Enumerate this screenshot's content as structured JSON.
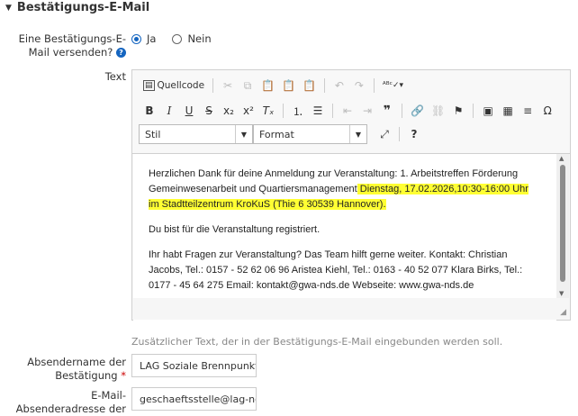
{
  "section": {
    "title": "Bestätigungs-E-Mail"
  },
  "confirm": {
    "label_line1": "Eine Bestätigungs-E-",
    "label_line2": "Mail versenden?",
    "help": "?",
    "yes": "Ja",
    "no": "Nein"
  },
  "text": {
    "label": "Text"
  },
  "toolbar": {
    "source": "Quellcode",
    "style": "Stil",
    "format": "Format"
  },
  "content": {
    "p1_a": "Herzlichen Dank für deine Anmeldung zur Veranstaltung: 1. Arbeitstreffen Förderung Gemeinwesenarbeit und Quartiersmanagement",
    "p1_b": " Dienstag, 17.02.2026,10:30-16:00 Uhr im Stadtteilzentrum KroKuS (Thie 6 30539 Hannover).",
    "p2": "Du bist für die Veranstaltung registriert.",
    "p3": "Ihr habt Fragen zur Veranstaltung? Das Team hilft gerne weiter. Kontakt: Christian Jacobs, Tel.: 0157 - 52 62 06 96 Aristea Kiehl, Tel.: 0163 - 40 52 077 Klara Birks, Tel.: 0177 - 45 64 275 Email: kontakt@gwa-nds.de Webseite: www.gwa-nds.de"
  },
  "hint": "Zusätzlicher Text, der in der Bestätigungs-E-Mail eingebunden werden soll.",
  "sender_name": {
    "label_line1": "Absendername der",
    "label_line2": "Bestätigung",
    "required": "*",
    "value": "LAG Soziale Brennpunkt"
  },
  "sender_email": {
    "label_line1": "E-Mail-",
    "label_line2": "Absenderadresse der",
    "value": "geschaeftsstelle@lag-nd"
  }
}
